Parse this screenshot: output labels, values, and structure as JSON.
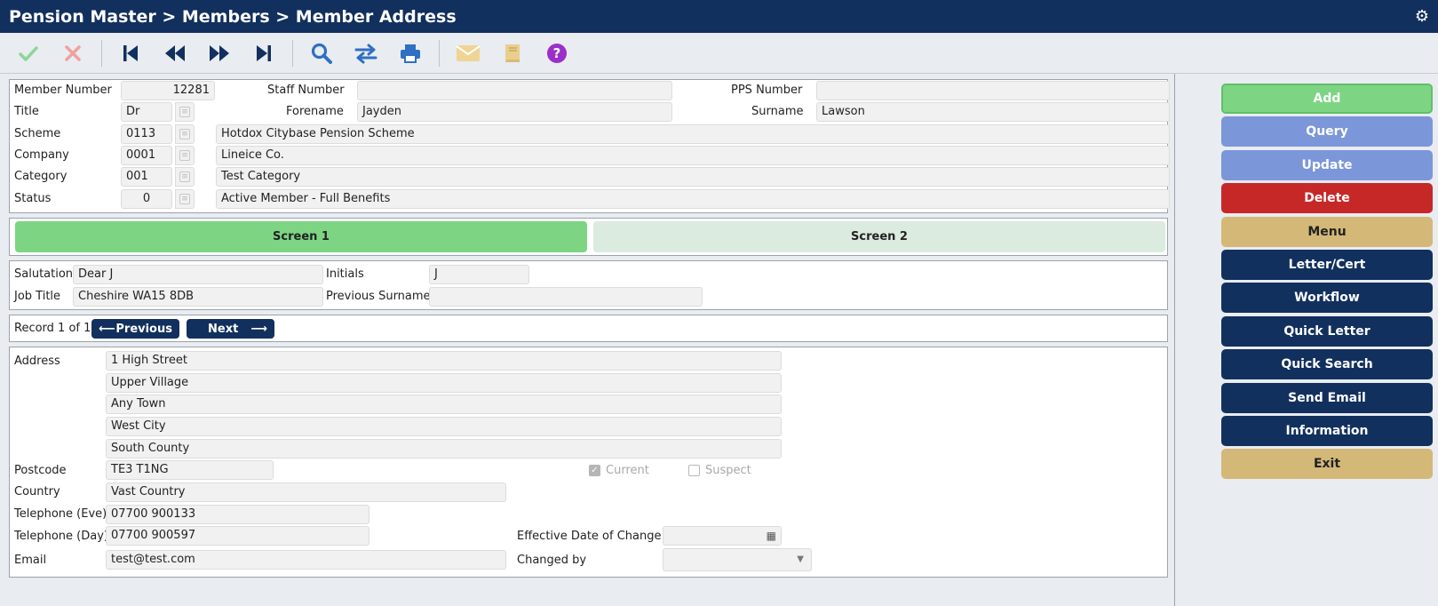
{
  "window": {
    "title": "Pension Master > Members > Member Address"
  },
  "colors": {
    "navy": "#12305e",
    "green": "#7dd584",
    "blue": "#7b96d9",
    "red": "#c62828",
    "tan": "#d4b877"
  },
  "toolbar": {
    "icons": [
      "check-icon",
      "cross-icon",
      "first-record-icon",
      "rewind-icon",
      "fast-forward-icon",
      "last-record-icon",
      "search-icon",
      "swap-icon",
      "print-icon",
      "email-icon",
      "book-icon",
      "help-icon"
    ]
  },
  "header": {
    "member_number_label": "Member Number",
    "member_number": "12281",
    "staff_number_label": "Staff Number",
    "staff_number": "",
    "pps_number_label": "PPS Number",
    "pps_number": "",
    "title_label": "Title",
    "title": "Dr",
    "forename_label": "Forename",
    "forename": "Jayden",
    "surname_label": "Surname",
    "surname": "Lawson",
    "scheme_label": "Scheme",
    "scheme_code": "0113",
    "scheme_name": "Hotdox Citybase Pension Scheme",
    "company_label": "Company",
    "company_code": "0001",
    "company_name": "Lineice Co.",
    "category_label": "Category",
    "category_code": "001",
    "category_name": "Test Category",
    "status_label": "Status",
    "status_code": "0",
    "status_name": "Active Member - Full Benefits"
  },
  "tabs": {
    "screen1": "Screen 1",
    "screen2": "Screen 2"
  },
  "details": {
    "salutation_label": "Salutation",
    "salutation": "Dear J",
    "initials_label": "Initials",
    "initials": "J",
    "job_title_label": "Job Title",
    "job_title": "Cheshire WA15 8DB",
    "previous_surname_label": "Previous Surname",
    "previous_surname": ""
  },
  "record_nav": {
    "record_text": "Record 1 of 1",
    "previous_label": "Previous",
    "previous_arrow": "⟵",
    "next_label": "Next",
    "next_arrow": "⟶"
  },
  "address": {
    "address_label": "Address",
    "lines": [
      "1 High Street",
      "Upper Village",
      "Any Town",
      "West City",
      "South County"
    ],
    "postcode_label": "Postcode",
    "postcode": "TE3 T1NG",
    "current_label": "Current",
    "current_checked": true,
    "suspect_label": "Suspect",
    "suspect_checked": false,
    "country_label": "Country",
    "country": "Vast Country",
    "tel_eve_label": "Telephone (Eve)",
    "tel_eve": "07700 900133",
    "tel_day_label": "Telephone (Day)",
    "tel_day": "07700 900597",
    "effective_date_label": "Effective Date of Change",
    "effective_date": "",
    "email_label": "Email",
    "email": "test@test.com",
    "changed_by_label": "Changed by",
    "changed_by": ""
  },
  "sidebar": {
    "add": "Add",
    "query": "Query",
    "update": "Update",
    "delete": "Delete",
    "menu": "Menu",
    "letter_cert": "Letter/Cert",
    "workflow": "Workflow",
    "quick_letter": "Quick Letter",
    "quick_search": "Quick Search",
    "send_email": "Send Email",
    "information": "Information",
    "exit": "Exit"
  }
}
